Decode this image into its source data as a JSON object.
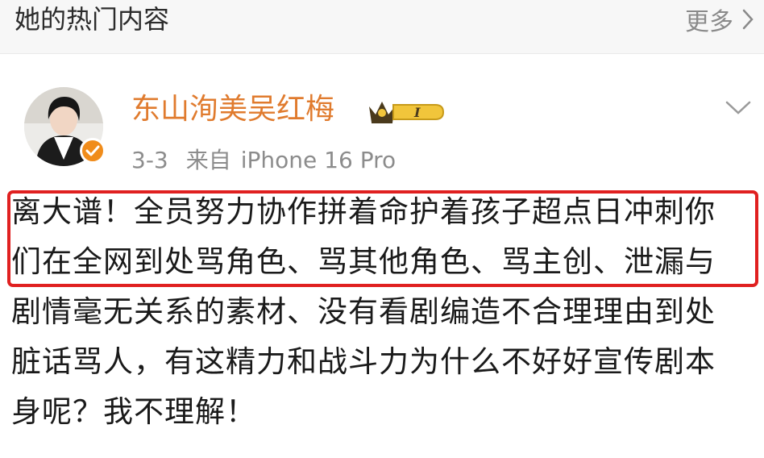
{
  "header": {
    "title": "她的热门内容",
    "more_label": "更多"
  },
  "post": {
    "author": {
      "name": "东山洵美吴红梅",
      "badge_level": "I"
    },
    "date": "3-3",
    "source_prefix": "来自",
    "source_device": "iPhone 16 Pro",
    "text": "离大谱！全员努力协作拼着命护着孩子超点日冲刺你\n们在全网到处骂角色、骂其他角色、骂主创、泄漏与\n剧情毫无关系的素材、没有看剧编造不合理理由到处\n脏话骂人，有这精力和战斗力为什么不好好宣传剧本\n身呢？我不理解！"
  },
  "icons": {
    "more_chevron": "chevron-right-icon",
    "dropdown": "chevron-down-icon",
    "verified": "verified-check-icon",
    "vip": "crown-badge-icon"
  },
  "colors": {
    "accent_name": "#e07b2e",
    "highlight": "#e02020",
    "verified": "#f08c1b",
    "muted": "#8c8c8c"
  }
}
